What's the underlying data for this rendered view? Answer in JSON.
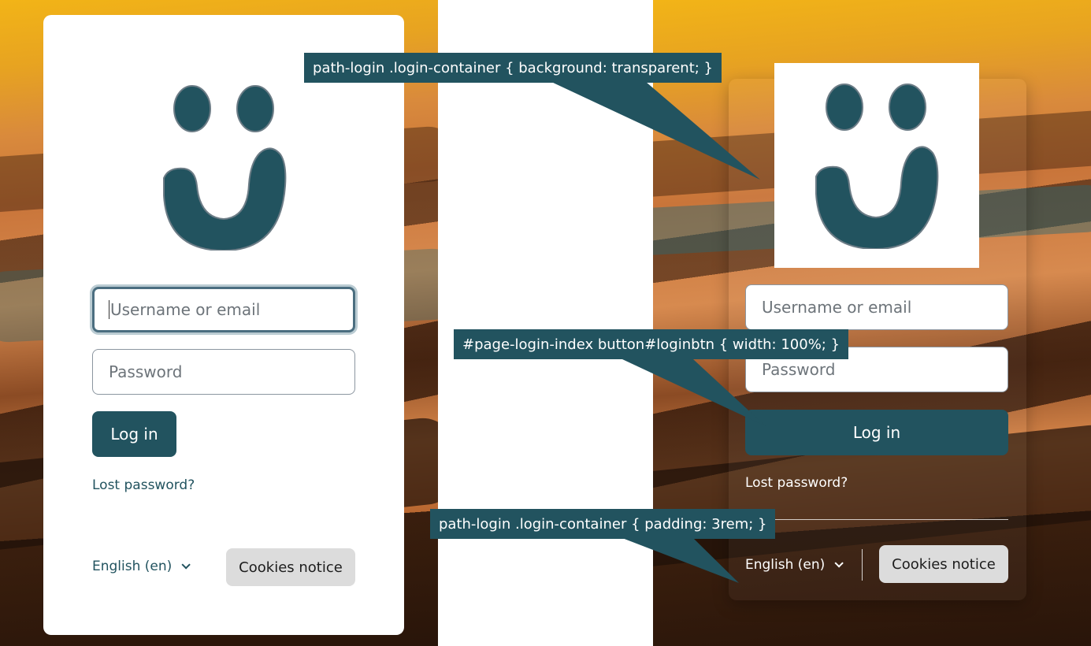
{
  "left_panel": {
    "username_placeholder": "Username or email",
    "password_placeholder": "Password",
    "login_label": "Log in",
    "lost_password": "Lost password?",
    "language": "English (en)",
    "cookies_label": "Cookies notice"
  },
  "right_panel": {
    "username_placeholder": "Username or email",
    "password_placeholder": "Password",
    "login_label": "Log in",
    "lost_password": "Lost password?",
    "language": "English (en)",
    "cookies_label": "Cookies notice"
  },
  "callouts": {
    "background": "path-login .login-container { background: transparent; }",
    "button_width": "#page-login-index button#loginbtn { width: 100%; }",
    "padding": "path-login .login-container { padding: 3rem; }"
  },
  "colors": {
    "accent": "#22535f",
    "card_bg": "#ffffff",
    "cookies_bg": "#dcdcdc"
  },
  "icons": {
    "logo": "smiley-logo-icon",
    "language_chevron": "chevron-down-icon"
  }
}
